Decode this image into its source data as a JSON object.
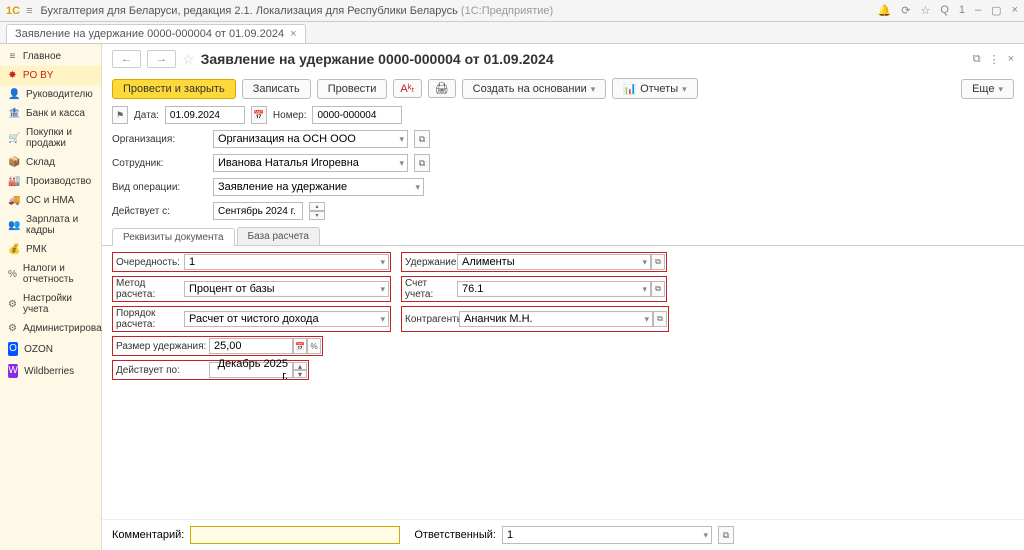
{
  "titlebar": {
    "logo": "1С",
    "app": "Бухгалтерия для Беларуси, редакция 2.1. Локализация для Республики Беларусь",
    "mode": "(1С:Предприятие)"
  },
  "doctab": {
    "label": "Заявление на удержание 0000-000004 от 01.09.2024",
    "close": "×"
  },
  "sidebar": {
    "items": [
      {
        "icon": "≡",
        "label": "Главное"
      },
      {
        "icon": "✸",
        "label": "PO BY"
      },
      {
        "icon": "👤",
        "label": "Руководителю"
      },
      {
        "icon": "🏦",
        "label": "Банк и касса"
      },
      {
        "icon": "🛒",
        "label": "Покупки и продажи"
      },
      {
        "icon": "📦",
        "label": "Склад"
      },
      {
        "icon": "🏭",
        "label": "Производство"
      },
      {
        "icon": "🚚",
        "label": "ОС и НМА"
      },
      {
        "icon": "👥",
        "label": "Зарплата и кадры"
      },
      {
        "icon": "💰",
        "label": "РМК"
      },
      {
        "icon": "%",
        "label": "Налоги и отчетность"
      },
      {
        "icon": "⚙",
        "label": "Настройки учета"
      },
      {
        "icon": "⚙",
        "label": "Администрирование"
      },
      {
        "icon": "O",
        "label": "OZON"
      },
      {
        "icon": "W",
        "label": "Wildberries"
      }
    ]
  },
  "header": {
    "nav_back": "←",
    "nav_fwd": "→",
    "title": "Заявление на удержание 0000-000004 от 01.09.2024"
  },
  "toolbar": {
    "primary": "Провести и закрыть",
    "save": "Записать",
    "post": "Провести",
    "create_based": "Создать на основании",
    "reports": "Отчеты",
    "more": "Еще"
  },
  "form": {
    "date_label": "Дата:",
    "date": "01.09.2024",
    "number_label": "Номер:",
    "number": "0000-000004",
    "org_label": "Организация:",
    "org": "Организация на ОСН ООО",
    "emp_label": "Сотрудник:",
    "emp": "Иванова Наталья Игоревна",
    "optype_label": "Вид операции:",
    "optype": "Заявление на удержание",
    "eff_label": "Действует с:",
    "eff": "Сентябрь 2024 г."
  },
  "tabs": {
    "t1": "Реквизиты документа",
    "t2": "База расчета"
  },
  "details": {
    "priority_label": "Очередность:",
    "priority": "1",
    "deduction_label": "Удержание:",
    "deduction": "Алименты",
    "method_label": "Метод расчета:",
    "method": "Процент от базы",
    "account_label": "Счет учета:",
    "account": "76.1",
    "order_label": "Порядок расчета:",
    "order": "Расчет от чистого дохода",
    "contractor_label": "Контрагенты:",
    "contractor": "Ананчик М.Н.",
    "size_label": "Размер удержания:",
    "size": "25,00",
    "pct": "%",
    "until_label": "Действует по:",
    "until": "Декабрь 2025 г."
  },
  "footer": {
    "comment_label": "Комментарий:",
    "comment": "",
    "resp_label": "Ответственный:",
    "resp": "1"
  }
}
